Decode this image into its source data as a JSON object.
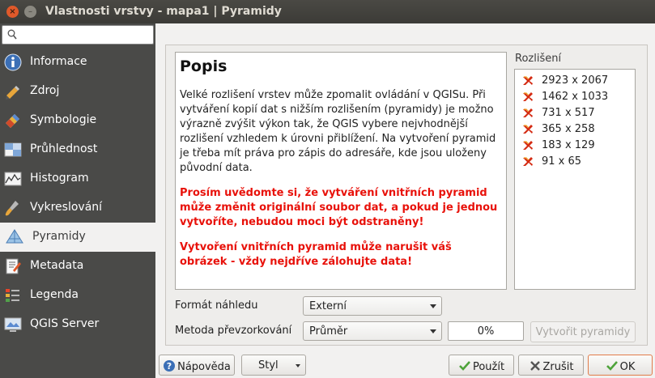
{
  "window": {
    "title": "Vlastnosti vrstvy - mapa1 | Pyramidy",
    "close_glyph": "×",
    "minimize_glyph": "–"
  },
  "sidebar": {
    "search_placeholder": "",
    "items": [
      {
        "label": "Informace",
        "icon": "info-icon"
      },
      {
        "label": "Zdroj",
        "icon": "source-icon"
      },
      {
        "label": "Symbologie",
        "icon": "symbology-icon"
      },
      {
        "label": "Průhlednost",
        "icon": "transparency-icon"
      },
      {
        "label": "Histogram",
        "icon": "histogram-icon"
      },
      {
        "label": "Vykreslování",
        "icon": "rendering-icon"
      },
      {
        "label": "Pyramidy",
        "icon": "pyramid-icon",
        "active": true
      },
      {
        "label": "Metadata",
        "icon": "metadata-icon"
      },
      {
        "label": "Legenda",
        "icon": "legend-icon"
      },
      {
        "label": "QGIS Server",
        "icon": "server-icon"
      }
    ]
  },
  "description": {
    "heading": "Popis",
    "body": "Velké rozlišení vrstev může zpomalit ovládání v QGISu. Při vytváření kopií dat s nižším rozlišením (pyramidy) je možno výrazně zvýšit výkon tak, že QGIS vybere nejvhodnější rozlišení vzhledem k úrovni přiblížení. Na vytvoření pyramid je třeba mít práva pro zápis do adresáře, kde jsou uloženy původní data.",
    "warning1": "Prosím uvědomte si, že vytváření vnitřních pyramid může změnit originální soubor dat, a pokud je jednou vytvoříte, nebudou moci být odstraněny!",
    "warning2": "Vytvoření vnitřních pyramid může narušit váš obrázek - vždy nejdříve zálohujte data!"
  },
  "resolutions": {
    "label": "Rozlišení",
    "items": [
      "2923 x 2067",
      "1462 x 1033",
      "731 x 517",
      "365 x 258",
      "183 x 129",
      "91 x 65"
    ]
  },
  "form": {
    "preview_format_label": "Formát náhledu",
    "preview_format_value": "Externí",
    "resampling_label": "Metoda převzorkování",
    "resampling_value": "Průměr",
    "progress_text": "0%",
    "progress_value": 0,
    "build_button": "Vytvořit pyramidy"
  },
  "footer": {
    "help": "Nápověda",
    "style": "Styl",
    "apply": "Použít",
    "cancel": "Zrušit",
    "ok": "OK"
  },
  "colors": {
    "sidebar_bg": "#4a4a48",
    "warning_text": "#e8110a",
    "accent_close": "#e0592a"
  }
}
